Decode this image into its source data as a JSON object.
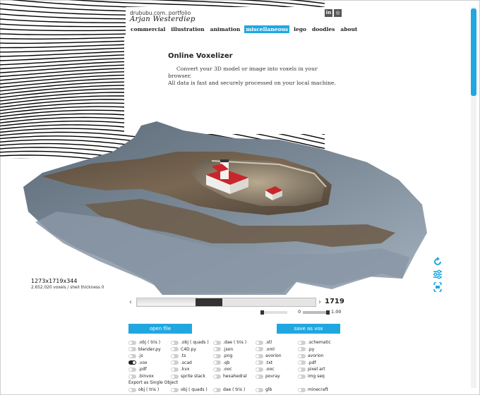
{
  "header": {
    "site_name": "drububu.com. portfolio",
    "signature": "Arjan Westerdiep",
    "social": [
      {
        "label": "in",
        "icon": "linkedin-icon"
      },
      {
        "label": "◎",
        "icon": "instagram-icon"
      }
    ]
  },
  "nav": [
    {
      "label": "commercial",
      "active": false
    },
    {
      "label": "illustration",
      "active": false
    },
    {
      "label": "animation",
      "active": false
    },
    {
      "label": "miscellaneous",
      "active": true
    },
    {
      "label": "lego",
      "active": false
    },
    {
      "label": "doodles",
      "active": false
    },
    {
      "label": "about",
      "active": false
    }
  ],
  "page": {
    "title": "Online Voxelizer",
    "description_line1": "Convert your 3D model or image into voxels in your browser.",
    "description_line2": "All data is fast and securely processed on your local machine."
  },
  "viewer": {
    "dimensions": "1273x1719x344",
    "stats": "2.652.020 voxels / shell thickness 0",
    "tools": [
      "rotate-icon",
      "settings-sliders-icon",
      "view-toggle-icon"
    ]
  },
  "slider": {
    "value_label": "1719",
    "position": 0.38,
    "prev_icon": "chevron-left-icon",
    "next_icon": "chevron-right-icon"
  },
  "mini_sliders": {
    "min_label": "0",
    "max_label": "1.00"
  },
  "buttons": {
    "open": "open file",
    "save": "save as vox"
  },
  "formats": {
    "rows": [
      [
        ".obj ( tris )",
        ".obj ( quads )",
        ".dae ( tris )",
        ".stl",
        ".schematic"
      ],
      [
        "blender.py",
        "C4D.py",
        ".json",
        ".xml",
        ".py"
      ],
      [
        ".js",
        ".ts",
        ".png",
        "avorion",
        "avorion"
      ],
      [
        ".vox",
        ".scad",
        ".qb",
        ".txt",
        ".pdf"
      ],
      [
        ".pdf",
        ".kvx",
        ".ooc",
        ".ooc",
        "pixel art"
      ],
      [
        ".binvox",
        "sprite stack",
        "hexahedral",
        "povray",
        "img seq"
      ]
    ],
    "selected": ".vox",
    "export_single_label": "Export as Single Object",
    "single_rows": [
      [
        "obj ( tris )",
        "obj ( quads )",
        "dae ( tris )",
        "glb",
        "minecraft"
      ]
    ]
  },
  "colors": {
    "accent": "#21a7e0",
    "text": "#222222"
  }
}
